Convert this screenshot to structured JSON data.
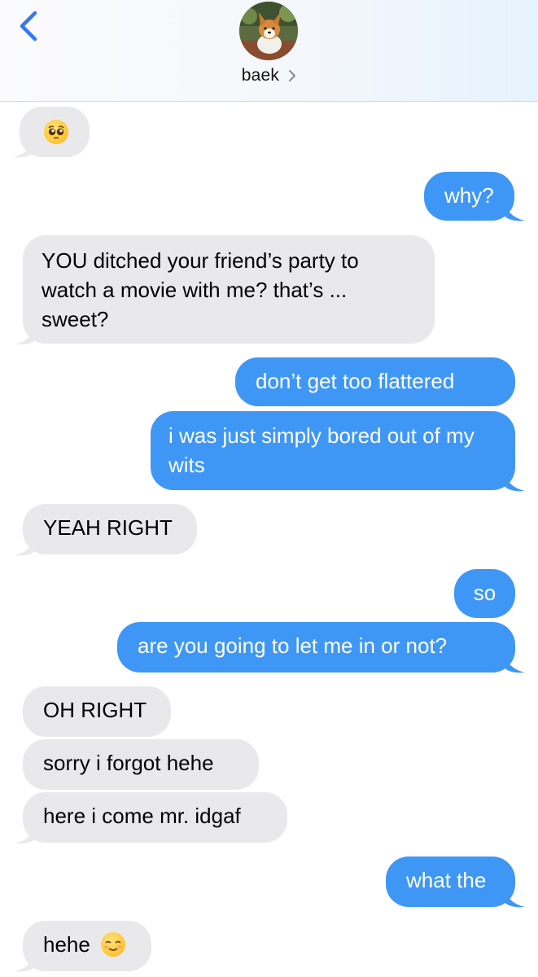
{
  "header": {
    "contact_name": "baek",
    "back_icon": "chevron-left-icon",
    "detail_icon": "chevron-right-icon",
    "avatar": "corgi-photo"
  },
  "colors": {
    "incoming_bubble": "#e9e9eb",
    "outgoing_bubble": "#3f97f5",
    "accent": "#3478f6"
  },
  "messages": [
    {
      "from": "them",
      "text": "",
      "emoji": "pleading-face-emoji"
    },
    {
      "from": "me",
      "text": "why?"
    },
    {
      "from": "them",
      "text": "YOU ditched your friend’s party to watch a movie with me? that’s ... sweet?"
    },
    {
      "from": "me",
      "text": "don’t get too flattered"
    },
    {
      "from": "me",
      "text": "i was just simply bored out of my wits"
    },
    {
      "from": "them",
      "text": "YEAH RIGHT"
    },
    {
      "from": "me",
      "text": "so"
    },
    {
      "from": "me",
      "text": "are you going to let me in or not?"
    },
    {
      "from": "them",
      "text": "OH RIGHT"
    },
    {
      "from": "them",
      "text": "sorry i forgot hehe"
    },
    {
      "from": "them",
      "text": "here i come mr. idgaf"
    },
    {
      "from": "me",
      "text": "what the"
    },
    {
      "from": "them",
      "text": "hehe",
      "emoji": "smiling-face-emoji"
    }
  ]
}
